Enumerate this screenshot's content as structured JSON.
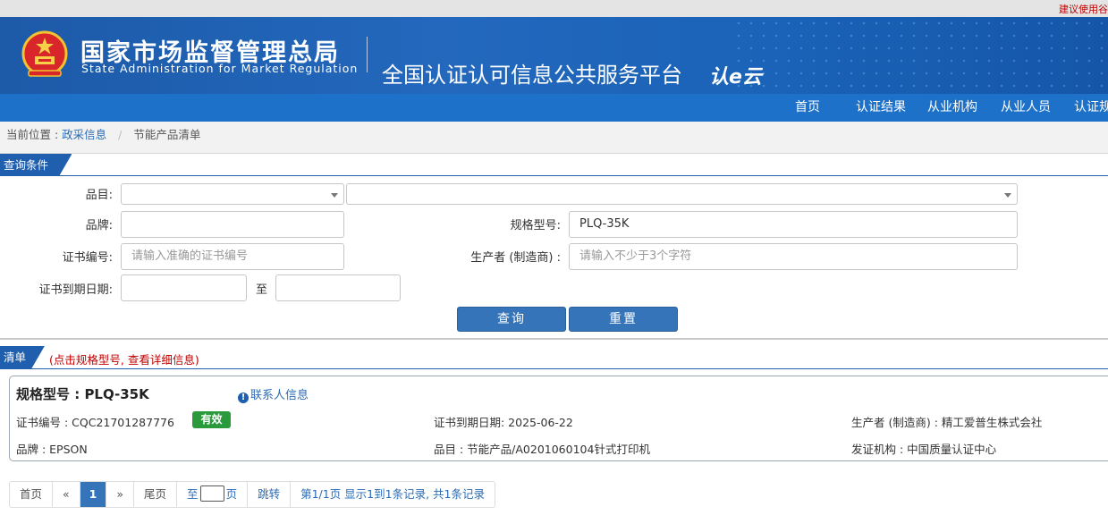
{
  "topbar": {
    "tip": "建议使用谷"
  },
  "banner": {
    "org_cn": "国家市场监督管理总局",
    "org_en": "State Administration  for  Market Regulation",
    "platform": "全国认证认可信息公共服务平台",
    "platform_logo": "认e云"
  },
  "nav": {
    "items": [
      "首页",
      "认证结果",
      "从业机构",
      "从业人员",
      "认证规"
    ]
  },
  "breadcrumb": {
    "prefix": "当前位置 :",
    "link": "政采信息",
    "sep": "/",
    "current": "节能产品清单"
  },
  "query": {
    "title": "查询条件",
    "category_label": "品目:",
    "category_value": "",
    "subcategory_value": "",
    "brand_label": "品牌:",
    "brand_value": "",
    "model_label": "规格型号:",
    "model_value": "PLQ-35K",
    "cert_no_label": "证书编号:",
    "cert_no_placeholder": "请输入准确的证书编号",
    "maker_label": "生产者  (制造商) :",
    "maker_placeholder": "请输入不少于3个字符",
    "expiry_label": "证书到期日期:",
    "expiry_from": "",
    "expiry_to_label": "至",
    "expiry_to": "",
    "search_button": "查询",
    "reset_button": "重置"
  },
  "list": {
    "title": "清单",
    "note": "(点击规格型号, 查看详细信息)",
    "record": {
      "model": "规格型号 : PLQ-35K",
      "contact": "联系人信息",
      "cert_no": "证书编号 : CQC21701287776",
      "status": "有效",
      "expiry": "证书到期日期: 2025-06-22",
      "maker": "生产者  (制造商) : 精工爱普生株式会社",
      "brand": "品牌 : EPSON",
      "category": "品目 : 节能产品/A0201060104针式打印机",
      "issuer": "发证机构 : 中国质量认证中心"
    }
  },
  "pager": {
    "first": "首页",
    "prev": "«",
    "current": "1",
    "next": "»",
    "last": "尾页",
    "goto_prefix": "至",
    "goto_suffix": "页",
    "jump": "跳转",
    "summary": "第1/1页  显示1到1条记录, 共1条记录"
  },
  "colors": {
    "banner": "#1d5aa8",
    "nav": "#1e71c9",
    "button": "#3574b9",
    "status_valid": "#2b9a3d",
    "note_red": "#c00000"
  }
}
